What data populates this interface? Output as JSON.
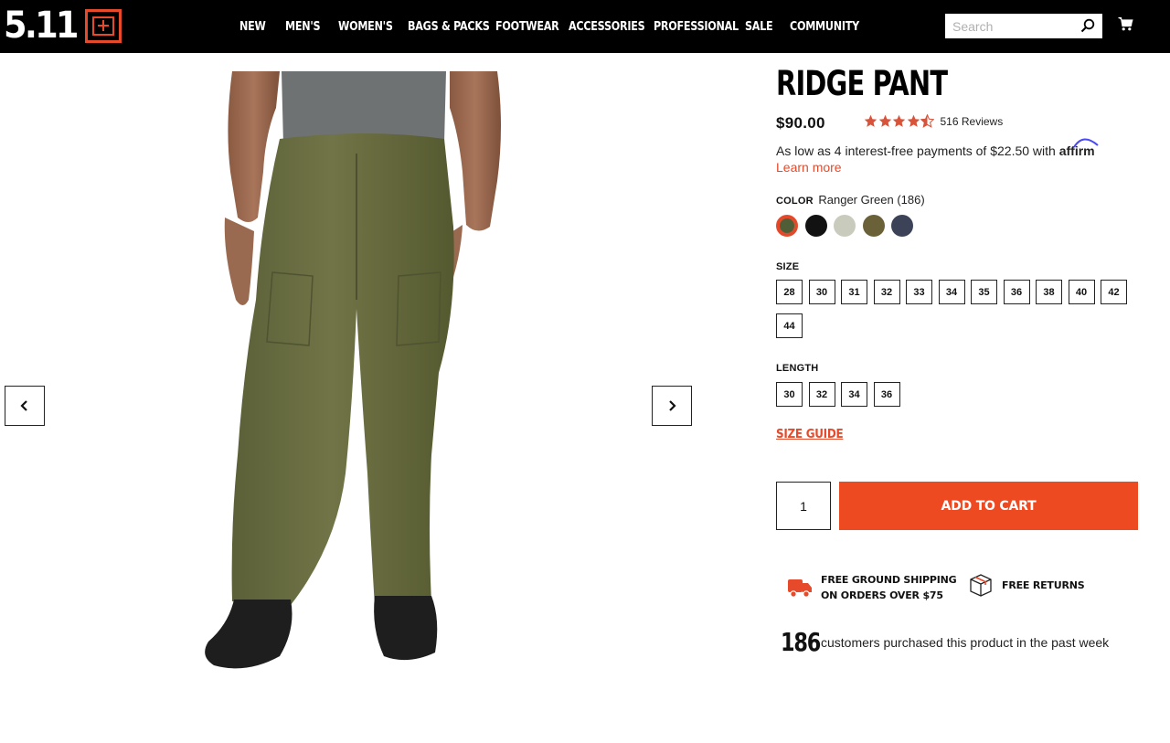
{
  "brand": {
    "logo_text": "5.11",
    "accent": "#e64a2a"
  },
  "nav": {
    "items": [
      "NEW",
      "MEN'S",
      "WOMEN'S",
      "BAGS & PACKS",
      "FOOTWEAR",
      "ACCESSORIES",
      "PROFESSIONAL",
      "SALE",
      "COMMUNITY"
    ]
  },
  "search": {
    "placeholder": "Search",
    "icon": "search-icon"
  },
  "cart": {
    "icon": "cart-icon"
  },
  "gallery": {
    "prev_icon": "chevron-left-icon",
    "next_icon": "chevron-right-icon"
  },
  "product": {
    "title": "RIDGE PANT",
    "price": "$90.00",
    "rating": 4.5,
    "reviews": "516 Reviews",
    "affirm_text": "As low as 4 interest-free payments of $22.50 with",
    "affirm_logo": "affirm",
    "learn_more": "Learn more",
    "color_label": "COLOR",
    "color_value": "Ranger Green (186)",
    "swatches": [
      {
        "color": "#4f5e37",
        "selected": true
      },
      {
        "color": "#121212",
        "selected": false
      },
      {
        "color": "#c9cbbd",
        "selected": false
      },
      {
        "color": "#6b6138",
        "selected": false
      },
      {
        "color": "#3c4257",
        "selected": false
      }
    ],
    "size_label": "SIZE",
    "sizes": [
      "28",
      "30",
      "31",
      "32",
      "33",
      "34",
      "35",
      "36",
      "38",
      "40",
      "42",
      "44"
    ],
    "length_label": "LENGTH",
    "lengths": [
      "30",
      "32",
      "34",
      "36"
    ],
    "size_guide": "SIZE GUIDE",
    "quantity": "1",
    "add_to_cart": "ADD TO CART",
    "add_to_cart_color": "#ee4a22",
    "perks": {
      "shipping_line1": "FREE GROUND SHIPPING",
      "shipping_line2": "ON ORDERS OVER $75",
      "returns": "FREE RETURNS"
    },
    "social_count": "186",
    "social_text": "customers purchased this product in the past week"
  }
}
